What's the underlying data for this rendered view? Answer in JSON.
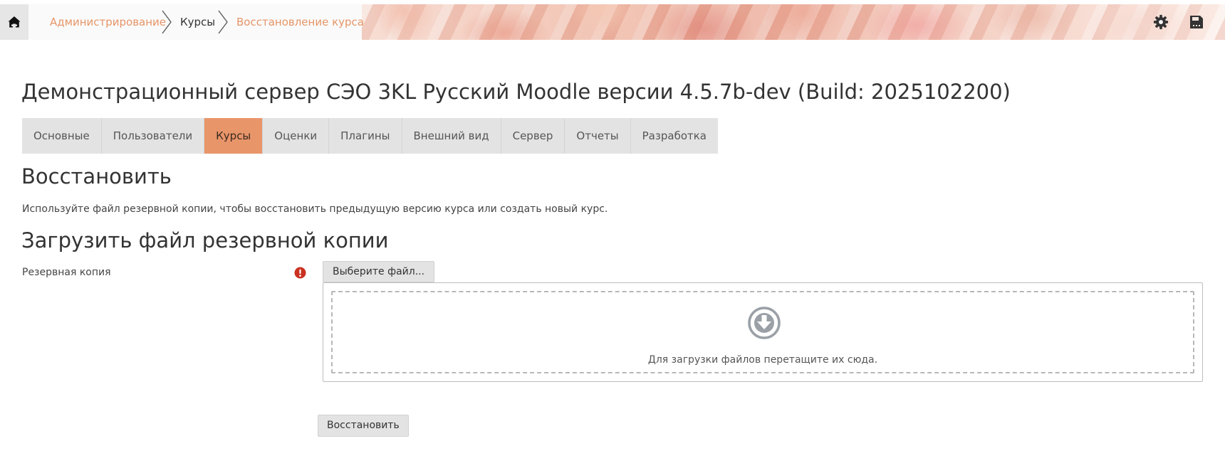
{
  "navbar": {
    "breadcrumbs": [
      {
        "label": "Администрирование",
        "type": "link"
      },
      {
        "label": "Курсы",
        "type": "current"
      },
      {
        "label": "Восстановление курса",
        "type": "link"
      }
    ],
    "icons": {
      "home": "home-icon",
      "settings": "gear-icon",
      "save": "floppy-icon"
    }
  },
  "page": {
    "title": "Демонстрационный сервер СЭО 3KL Русский Moodle версии 4.5.7b-dev (Build: 2025102200)"
  },
  "tabs": [
    {
      "label": "Основные",
      "active": false
    },
    {
      "label": "Пользователи",
      "active": false
    },
    {
      "label": "Курсы",
      "active": true
    },
    {
      "label": "Оценки",
      "active": false
    },
    {
      "label": "Плагины",
      "active": false
    },
    {
      "label": "Внешний вид",
      "active": false
    },
    {
      "label": "Сервер",
      "active": false
    },
    {
      "label": "Отчеты",
      "active": false
    },
    {
      "label": "Разработка",
      "active": false
    }
  ],
  "restore": {
    "heading": "Восстановить",
    "description": "Используйте файл резервной копии, чтобы восстановить предыдущую версию курса или создать новый курс.",
    "upload_heading": "Загрузить файл резервной копии",
    "field_label": "Резервная копия",
    "choose_button": "Выберите файл...",
    "drop_text": "Для загрузки файлов перетащите их сюда.",
    "submit_button": "Восстановить"
  },
  "colors": {
    "accent": "#e9956a",
    "link": "#e69568",
    "required": "#ca3120",
    "tab_bg": "#e3e3e3"
  }
}
